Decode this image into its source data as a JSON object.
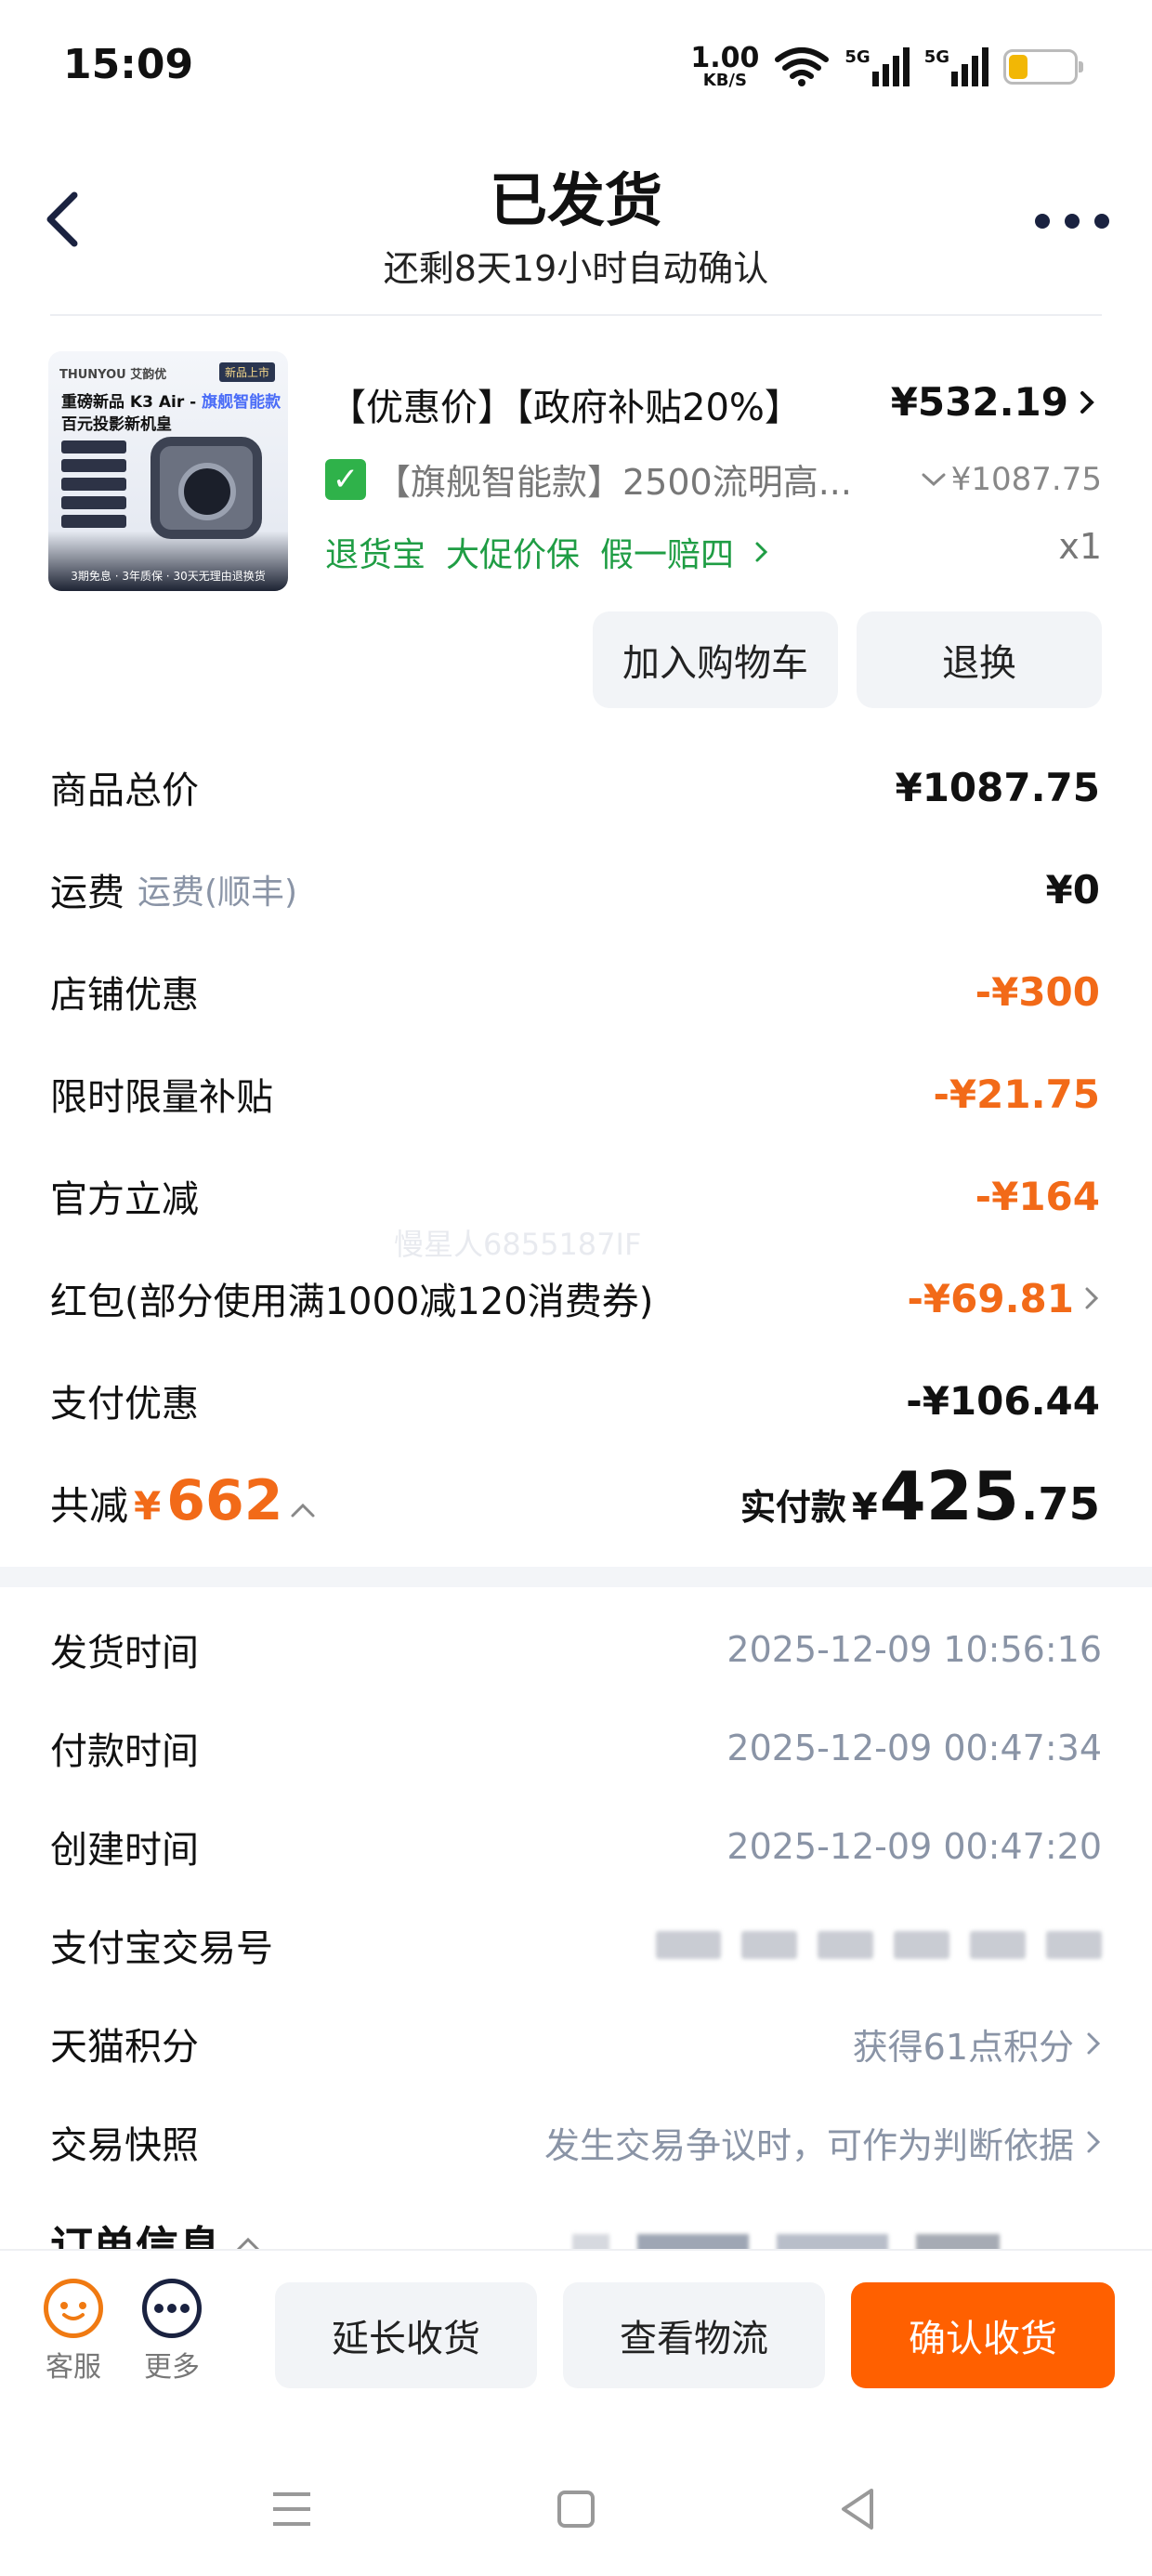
{
  "status_bar": {
    "time": "15:09",
    "net_speed_value": "1.00",
    "net_speed_unit": "KB/S",
    "signal_label_1": "5G",
    "signal_label_2": "5G",
    "battery": "11"
  },
  "header": {
    "title": "已发货",
    "subtitle": "还剩8天19小时自动确认"
  },
  "product": {
    "thumb_brand": "THUNYOU 艾韵优",
    "thumb_tag": "新品上市",
    "thumb_line1_a": "重磅新品 K3 Air - ",
    "thumb_line1_b": "旗舰智能款",
    "thumb_line2": "百元投影新机皇",
    "thumb_footer": "3期免息 · 3年质保 · 30天无理由退换货",
    "title": "【优惠价】【政府补贴20%】",
    "price": "¥532.19",
    "spec": "【旗舰智能款】2500流明高...",
    "original_price": "¥1087.75",
    "services": [
      "退货宝",
      "大促价保",
      "假一赔四"
    ],
    "quantity": "x1",
    "btn_cart": "加入购物车",
    "btn_return": "退换"
  },
  "price_rows": [
    {
      "label": "商品总价",
      "sub": "",
      "value": "¥1087.75",
      "orange": false
    },
    {
      "label": "运费",
      "sub": "运费(顺丰)",
      "value": "¥0",
      "orange": false
    },
    {
      "label": "店铺优惠",
      "sub": "",
      "value": "-¥300",
      "orange": true
    },
    {
      "label": "限时限量补贴",
      "sub": "",
      "value": "-¥21.75",
      "orange": true
    },
    {
      "label": "官方立减",
      "sub": "",
      "value": "-¥164",
      "orange": true
    },
    {
      "label": "红包(部分使用满1000减120消费券)",
      "sub": "",
      "value": "-¥69.81",
      "orange": true
    },
    {
      "label": "支付优惠",
      "sub": "",
      "value": "-¥106.44",
      "orange": false
    }
  ],
  "totals": {
    "discount_label": "共减",
    "discount_currency": "¥",
    "discount_amount": "662",
    "paid_label": "实付款",
    "paid_currency": "¥",
    "paid_int": "425",
    "paid_dec": ".75"
  },
  "watermark": "慢星人6855187IF",
  "info_rows": [
    {
      "label": "发货时间",
      "value": "2025-12-09 10:56:16"
    },
    {
      "label": "付款时间",
      "value": "2025-12-09 00:47:34"
    },
    {
      "label": "创建时间",
      "value": "2025-12-09 00:47:20"
    },
    {
      "label": "支付宝交易号",
      "value": ""
    },
    {
      "label": "天猫积分",
      "value": "获得61点积分"
    },
    {
      "label": "交易快照",
      "value": "发生交易争议时，可作为判断依据"
    }
  ],
  "order_info_label": "订单信息",
  "bottom_bar": {
    "kefu": "客服",
    "more": "更多",
    "extend": "延长收货",
    "logistics": "查看物流",
    "confirm": "确认收货"
  },
  "colors": {
    "accent_orange": "#ff6000",
    "discount_orange": "#f26a18",
    "service_green": "#1f9d44",
    "muted_gray": "#8a94a6"
  }
}
